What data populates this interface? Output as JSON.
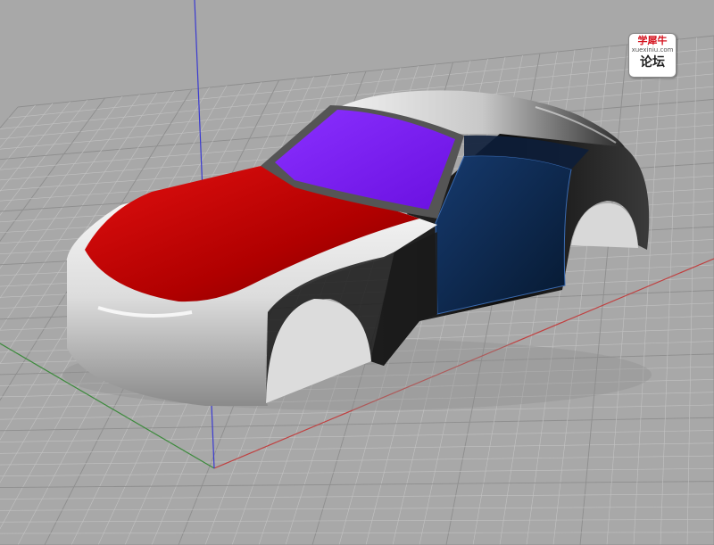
{
  "viewport": {
    "background_color": "#a8a8a8",
    "grid_line_color": "#c2c2c2",
    "grid_major_color": "#8e8e8e"
  },
  "axes": {
    "x_axis_color": "#c04040",
    "y_axis_color": "#3c8a3c",
    "z_axis_color": "#3a3ad0"
  },
  "model": {
    "body_color": "#e8e8e8",
    "hood_color": "#c00000",
    "windshield_color": "#7a18ff",
    "door_color": "#0a2a55",
    "rear_color": "#151515"
  },
  "watermark": {
    "top_text": "学犀牛",
    "url_text": "xuexiniu.com",
    "bottom_text": "论坛"
  }
}
